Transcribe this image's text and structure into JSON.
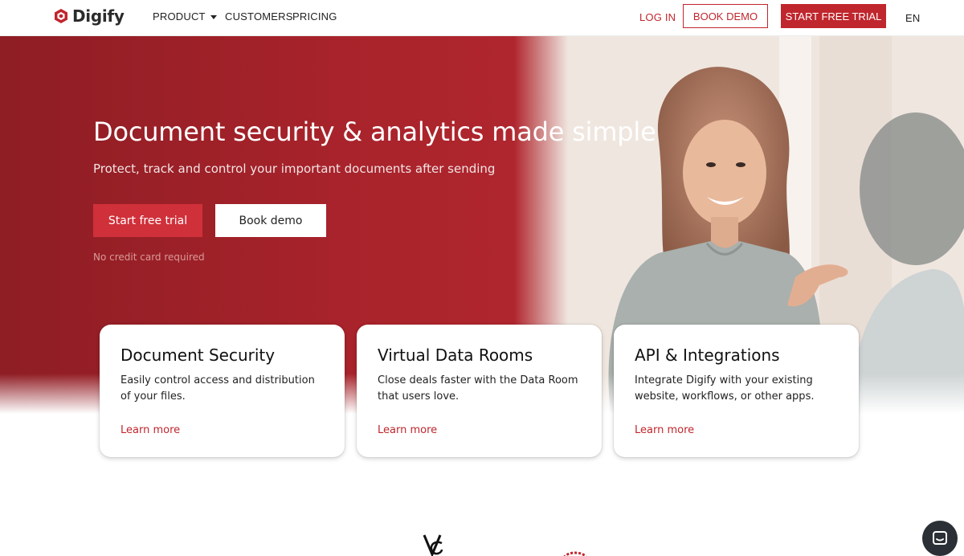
{
  "brand": {
    "name": "Digify",
    "accent": "#c0262d"
  },
  "nav": {
    "product": "PRODUCT",
    "customers": "CUSTOMERS",
    "pricing": "PRICING",
    "login": "LOG IN",
    "book_demo": "BOOK DEMO",
    "start_trial": "START FREE TRIAL",
    "lang": "EN"
  },
  "hero": {
    "title": "Document security & analytics made simple",
    "subtitle": "Protect, track and control your important documents after sending",
    "primary_button": "Start free trial",
    "secondary_button": "Book demo",
    "note": "No credit card required"
  },
  "cards": [
    {
      "title": "Document Security",
      "description": "Easily control access and distribution of your files.",
      "link": "Learn more"
    },
    {
      "title": "Virtual Data Rooms",
      "description": "Close deals faster with the Data Room that users love.",
      "link": "Learn more"
    },
    {
      "title": "API & Integrations",
      "description": "Integrate Digify with your existing website, workflows, or other apps.",
      "link": "Learn more"
    }
  ],
  "icons": {
    "logo": "hexagon-logo-icon",
    "product_caret": "caret-down-icon",
    "chat": "chat-icon"
  }
}
